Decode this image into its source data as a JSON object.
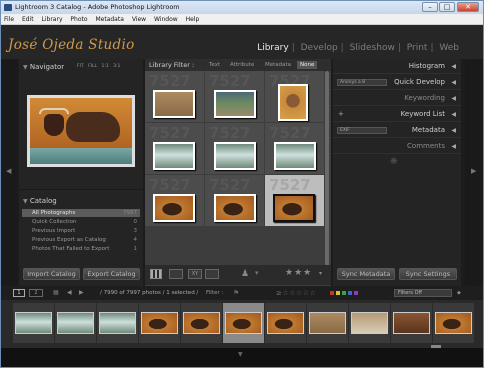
{
  "window": {
    "title": "Lightroom 3 Catalog - Adobe Photoshop Lightroom",
    "min": "–",
    "max": "□",
    "close": "✕"
  },
  "menu": [
    "File",
    "Edit",
    "Library",
    "Photo",
    "Metadata",
    "View",
    "Window",
    "Help"
  ],
  "identity": {
    "brand": "José Ojeda Studio"
  },
  "modules": [
    "Library",
    "Develop",
    "Slideshow",
    "Print",
    "Web"
  ],
  "navigator": {
    "title": "Navigator",
    "zoom": [
      "FIT",
      "FILL",
      "1:1",
      "3:1"
    ]
  },
  "catalog": {
    "title": "Catalog",
    "items": [
      {
        "label": "All Photographs",
        "count": "7997"
      },
      {
        "label": "Quick Collection",
        "count": "0"
      },
      {
        "label": "Previous Import",
        "count": "3"
      },
      {
        "label": "Previous Export as Catalog",
        "count": "4"
      },
      {
        "label": "Photos That Failed to Export",
        "count": "1"
      }
    ]
  },
  "left_buttons": {
    "import": "Import Catalog",
    "export": "Export Catalog"
  },
  "filter_bar": {
    "label": "Library Filter :",
    "options": [
      "Text",
      "Attribute",
      "Metadata",
      "None"
    ],
    "active": "None"
  },
  "grid": {
    "watermark": "7527"
  },
  "right_panels": {
    "histogram": "Histogram",
    "quick_develop": "Quick Develop",
    "quick_develop_preset": "Anonys a 8",
    "keywording": "Keywording",
    "keyword_list": "Keyword List",
    "metadata": "Metadata",
    "metadata_preset": "EXIF",
    "comments": "Comments",
    "add_glyph": "+"
  },
  "right_buttons": {
    "sync_metadata": "Sync Metadata",
    "sync_settings": "Sync Settings"
  },
  "filmstrip_bar": {
    "page1": "1",
    "page2": "2",
    "info": "/ 7990 of 7997 photos / 1 selected /",
    "filter_label": "Filter :",
    "filters_off": "Filters Off"
  },
  "colors": {
    "brand": "#d09a4a",
    "selection": "#bdbdbd",
    "accent_label": [
      "#c03a2a",
      "#d8c23a",
      "#3aa33a",
      "#3a6ac0",
      "#8a3ac0"
    ]
  }
}
